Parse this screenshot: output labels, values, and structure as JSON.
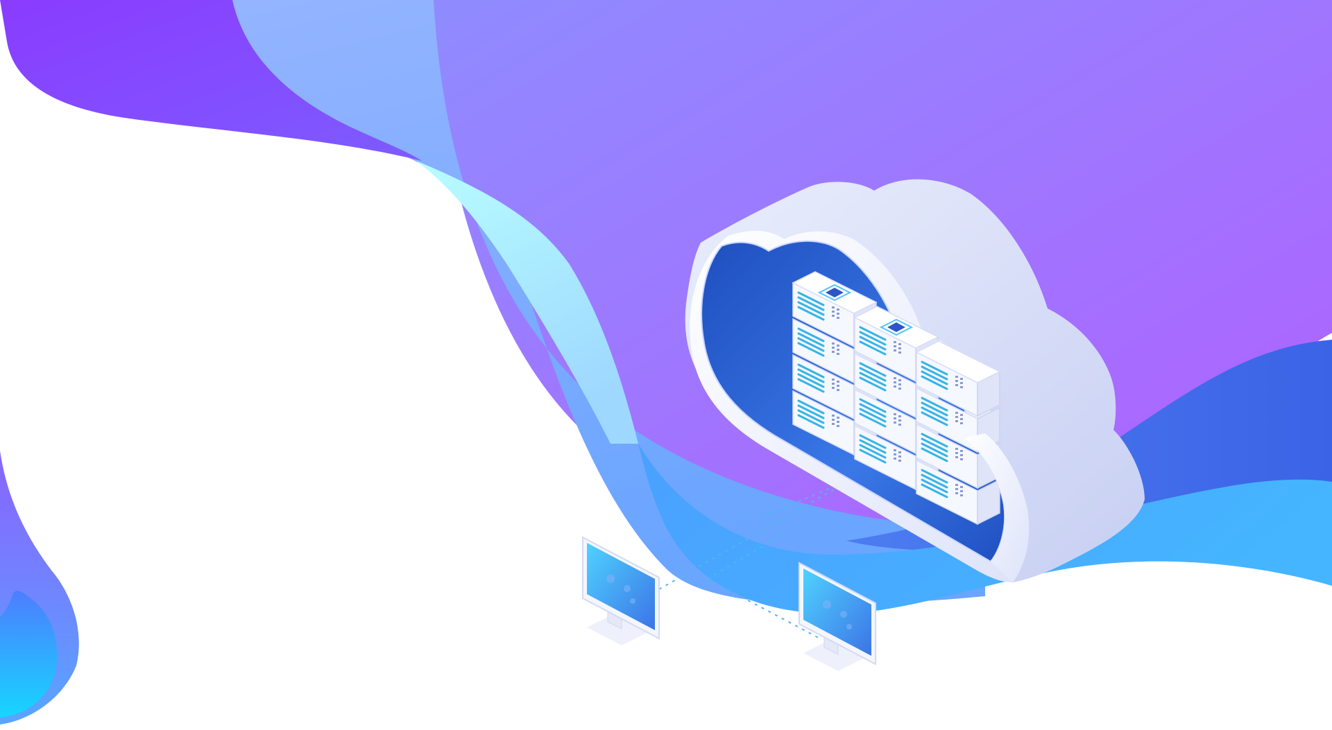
{
  "scene": {
    "subject": "cloud-server-illustration",
    "icons": [
      "cloud-icon",
      "server-rack-icon",
      "monitor-icon",
      "network-link-icon"
    ]
  },
  "colors": {
    "background": "#ffffff",
    "violet": "#8a3cff",
    "purple": "#a855ff",
    "lavender": "#9b85ff",
    "sky_blue": "#8fb3ff",
    "cyan": "#b6fbff",
    "blue": "#3f6fe8",
    "azure": "#49a6ff",
    "cloud_white": "#f2f4fd",
    "cloud_inner": "#2a5ed0",
    "server_white": "#f6f8ff",
    "server_line": "#35b3e6",
    "screen": "#4a9de8"
  },
  "servers": {
    "columns": 3,
    "units_per_column": 4
  },
  "monitors": {
    "count": 2
  }
}
